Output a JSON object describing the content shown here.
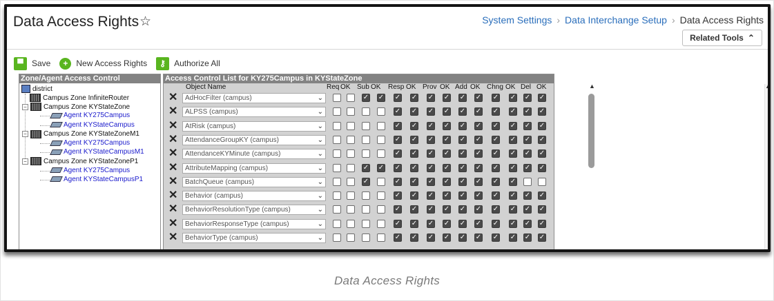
{
  "header": {
    "title": "Data Access Rights",
    "breadcrumb": [
      "System Settings",
      "Data Interchange Setup",
      "Data Access Rights"
    ],
    "related_tools": "Related Tools"
  },
  "toolbar": {
    "save": "Save",
    "new_rights": "New Access Rights",
    "authorize_all": "Authorize All"
  },
  "tree": {
    "title": "Zone/Agent Access Control",
    "root": "district",
    "nodes": [
      {
        "label": "Campus Zone InfiniteRouter",
        "kind": "zone"
      },
      {
        "label": "Campus Zone KYStateZone",
        "kind": "zone"
      },
      {
        "label": "Agent KY275Campus",
        "kind": "agent"
      },
      {
        "label": "Agent KYStateCampus",
        "kind": "agent"
      },
      {
        "label": "Campus Zone KYStateZoneM1",
        "kind": "zone"
      },
      {
        "label": "Agent KY275Campus",
        "kind": "agent"
      },
      {
        "label": "Agent KYStateCampusM1",
        "kind": "agent"
      },
      {
        "label": "Campus Zone KYStateZoneP1",
        "kind": "zone"
      },
      {
        "label": "Agent KY275Campus",
        "kind": "agent"
      },
      {
        "label": "Agent KYStateCampusP1",
        "kind": "agent"
      }
    ]
  },
  "acl": {
    "title": "Access Control List for KY275Campus in KYStateZone",
    "columns": [
      "Object Name",
      "Req",
      "OK",
      "Sub",
      "OK",
      "Resp",
      "OK",
      "Prov",
      "OK",
      "Add",
      "OK",
      "Chng",
      "OK",
      "Del",
      "OK"
    ],
    "rows": [
      {
        "name": "AdHocFilter (campus)",
        "flags": [
          0,
          0,
          1,
          1,
          1,
          1,
          1,
          1,
          1,
          1,
          1,
          1,
          1,
          1
        ]
      },
      {
        "name": "ALPSS (campus)",
        "flags": [
          0,
          0,
          0,
          0,
          1,
          1,
          1,
          1,
          1,
          1,
          1,
          1,
          1,
          1
        ]
      },
      {
        "name": "AtRisk (campus)",
        "flags": [
          0,
          0,
          0,
          0,
          1,
          1,
          1,
          1,
          1,
          1,
          1,
          1,
          1,
          1
        ]
      },
      {
        "name": "AttendanceGroupKY (campus)",
        "flags": [
          0,
          0,
          0,
          0,
          1,
          1,
          1,
          1,
          1,
          1,
          1,
          1,
          1,
          1
        ]
      },
      {
        "name": "AttendanceKYMinute (campus)",
        "flags": [
          0,
          0,
          0,
          0,
          1,
          1,
          1,
          1,
          1,
          1,
          1,
          1,
          1,
          1
        ]
      },
      {
        "name": "AttributeMapping (campus)",
        "flags": [
          0,
          0,
          1,
          1,
          1,
          1,
          1,
          1,
          1,
          1,
          1,
          1,
          1,
          1
        ]
      },
      {
        "name": "BatchQueue (campus)",
        "flags": [
          0,
          0,
          1,
          0,
          1,
          1,
          1,
          1,
          1,
          1,
          1,
          1,
          0,
          0
        ]
      },
      {
        "name": "Behavior (campus)",
        "flags": [
          0,
          0,
          0,
          0,
          1,
          1,
          1,
          1,
          1,
          1,
          1,
          1,
          1,
          1
        ]
      },
      {
        "name": "BehaviorResolutionType (campus)",
        "flags": [
          0,
          0,
          0,
          0,
          1,
          1,
          1,
          1,
          1,
          1,
          1,
          1,
          1,
          1
        ]
      },
      {
        "name": "BehaviorResponseType (campus)",
        "flags": [
          0,
          0,
          0,
          0,
          1,
          1,
          1,
          1,
          1,
          1,
          1,
          1,
          1,
          1
        ]
      },
      {
        "name": "BehaviorType (campus)",
        "flags": [
          0,
          0,
          0,
          0,
          1,
          1,
          1,
          1,
          1,
          1,
          1,
          1,
          1,
          1
        ]
      }
    ]
  },
  "caption": "Data Access Rights"
}
